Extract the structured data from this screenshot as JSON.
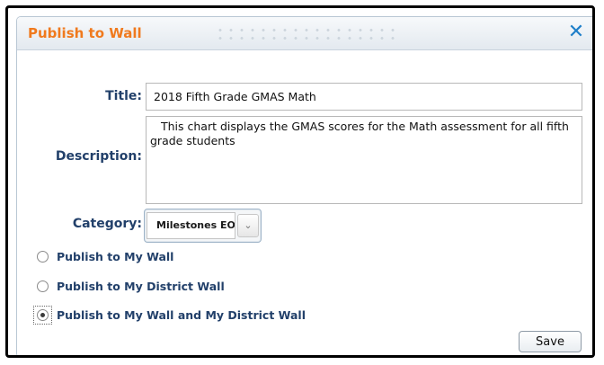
{
  "dialog": {
    "title": "Publish to Wall",
    "close_symbol": "✕",
    "close_icon": "close-icon",
    "title_color": "#f07a1e"
  },
  "form": {
    "title_label": "Title:",
    "title_value": "2018 Fifth Grade GMAS Math",
    "description_label": "Description:",
    "description_value": " This chart displays the GMAS scores for the Math assessment for all fifth grade students",
    "category_label": "Category:",
    "category_value": "Milestones EOG",
    "category_arrow_icon": "chevron-down-icon"
  },
  "publish_options": [
    {
      "label": "Publish to My Wall",
      "checked": false
    },
    {
      "label": "Publish to My District Wall",
      "checked": false
    },
    {
      "label": "Publish to My Wall and My District Wall",
      "checked": true
    }
  ],
  "actions": {
    "save_label": "Save"
  }
}
